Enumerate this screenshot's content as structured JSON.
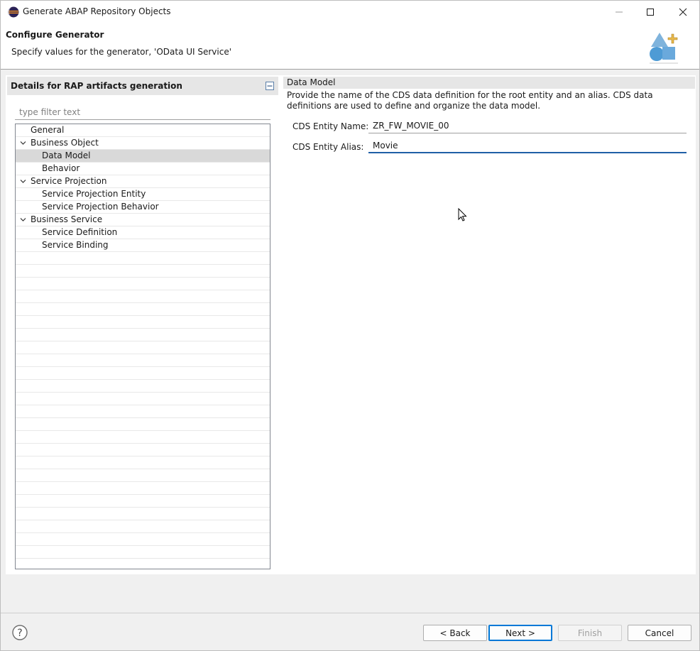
{
  "window": {
    "title": "Generate ABAP Repository Objects"
  },
  "banner": {
    "title": "Configure Generator",
    "subtitle": "Specify values for the generator, 'OData UI Service'"
  },
  "left_panel": {
    "title": "Details for RAP artifacts generation",
    "filter_placeholder": "type filter text",
    "tree": [
      {
        "label": "General",
        "level": 0,
        "expandable": false,
        "selected": false
      },
      {
        "label": "Business Object",
        "level": 0,
        "expandable": true,
        "selected": false
      },
      {
        "label": "Data Model",
        "level": 1,
        "expandable": false,
        "selected": true
      },
      {
        "label": "Behavior",
        "level": 1,
        "expandable": false,
        "selected": false
      },
      {
        "label": "Service Projection",
        "level": 0,
        "expandable": true,
        "selected": false
      },
      {
        "label": "Service Projection Entity",
        "level": 1,
        "expandable": false,
        "selected": false
      },
      {
        "label": "Service Projection Behavior",
        "level": 1,
        "expandable": false,
        "selected": false
      },
      {
        "label": "Business Service",
        "level": 0,
        "expandable": true,
        "selected": false
      },
      {
        "label": "Service Definition",
        "level": 1,
        "expandable": false,
        "selected": false
      },
      {
        "label": "Service Binding",
        "level": 1,
        "expandable": false,
        "selected": false
      }
    ]
  },
  "right_panel": {
    "title": "Data Model",
    "description": "Provide the name of the CDS data definition for the root entity and an alias. CDS data definitions are used to define and organize the data model.",
    "entity_name_label": "CDS Entity Name: *",
    "entity_name_value": "ZR_FW_MOVIE_00",
    "entity_alias_label": "CDS Entity Alias:",
    "entity_alias_value": "Movie"
  },
  "buttons": {
    "back": "< Back",
    "next": "Next >",
    "finish": "Finish",
    "cancel": "Cancel"
  },
  "colors": {
    "focus_accent": "#1f5fa6",
    "primary_border": "#0078d7",
    "selected_row": "#d9d9d9"
  }
}
